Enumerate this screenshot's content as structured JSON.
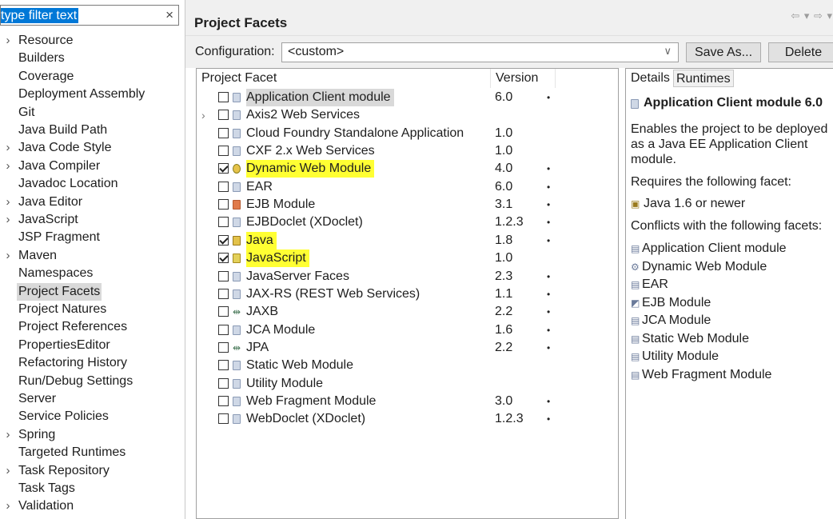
{
  "filter": {
    "text": "type filter text",
    "clear_icon": "×"
  },
  "tree": {
    "items": [
      {
        "label": "Resource",
        "expandable": true
      },
      {
        "label": "Builders",
        "expandable": false
      },
      {
        "label": "Coverage",
        "expandable": false
      },
      {
        "label": "Deployment Assembly",
        "expandable": false
      },
      {
        "label": "Git",
        "expandable": false
      },
      {
        "label": "Java Build Path",
        "expandable": false
      },
      {
        "label": "Java Code Style",
        "expandable": true
      },
      {
        "label": "Java Compiler",
        "expandable": true
      },
      {
        "label": "Javadoc Location",
        "expandable": false
      },
      {
        "label": "Java Editor",
        "expandable": true
      },
      {
        "label": "JavaScript",
        "expandable": true
      },
      {
        "label": "JSP Fragment",
        "expandable": false
      },
      {
        "label": "Maven",
        "expandable": true
      },
      {
        "label": "Namespaces",
        "expandable": false
      },
      {
        "label": "Project Facets",
        "expandable": false,
        "selected": true
      },
      {
        "label": "Project Natures",
        "expandable": false
      },
      {
        "label": "Project References",
        "expandable": false
      },
      {
        "label": "PropertiesEditor",
        "expandable": false
      },
      {
        "label": "Refactoring History",
        "expandable": false
      },
      {
        "label": "Run/Debug Settings",
        "expandable": false
      },
      {
        "label": "Server",
        "expandable": false
      },
      {
        "label": "Service Policies",
        "expandable": false
      },
      {
        "label": "Spring",
        "expandable": true
      },
      {
        "label": "Targeted Runtimes",
        "expandable": false
      },
      {
        "label": "Task Repository",
        "expandable": true
      },
      {
        "label": "Task Tags",
        "expandable": false
      },
      {
        "label": "Validation",
        "expandable": true
      }
    ]
  },
  "header": {
    "title": "Project Facets",
    "nav": "⇦ ▾ ⇨ ▾"
  },
  "config": {
    "label": "Configuration:",
    "value": "<custom>",
    "save_as": "Save As...",
    "delete": "Delete"
  },
  "facets": {
    "col_facet": "Project Facet",
    "col_version": "Version",
    "rows": [
      {
        "name": "Application Client module",
        "version": "6.0",
        "checked": false,
        "dropdown": true,
        "icon": "doc",
        "style": "sel",
        "expander": false
      },
      {
        "name": "Axis2 Web Services",
        "version": "",
        "checked": false,
        "dropdown": false,
        "icon": "doc",
        "style": "",
        "expander": true
      },
      {
        "name": "Cloud Foundry Standalone Application",
        "version": "1.0",
        "checked": false,
        "dropdown": false,
        "icon": "doc",
        "style": "",
        "expander": false
      },
      {
        "name": "CXF 2.x Web Services",
        "version": "1.0",
        "checked": false,
        "dropdown": false,
        "icon": "doc",
        "style": "",
        "expander": false
      },
      {
        "name": "Dynamic Web Module",
        "version": "4.0",
        "checked": true,
        "dropdown": true,
        "icon": "gear",
        "style": "hl",
        "expander": false
      },
      {
        "name": "EAR",
        "version": "6.0",
        "checked": false,
        "dropdown": true,
        "icon": "doc",
        "style": "",
        "expander": false
      },
      {
        "name": "EJB Module",
        "version": "3.1",
        "checked": false,
        "dropdown": true,
        "icon": "ejb",
        "style": "",
        "expander": false
      },
      {
        "name": "EJBDoclet (XDoclet)",
        "version": "1.2.3",
        "checked": false,
        "dropdown": true,
        "icon": "doc",
        "style": "",
        "expander": false
      },
      {
        "name": "Java",
        "version": "1.8",
        "checked": true,
        "dropdown": true,
        "icon": "java",
        "style": "hl",
        "expander": false
      },
      {
        "name": "JavaScript",
        "version": "1.0",
        "checked": true,
        "dropdown": false,
        "icon": "js",
        "style": "hl",
        "expander": false
      },
      {
        "name": "JavaServer Faces",
        "version": "2.3",
        "checked": false,
        "dropdown": true,
        "icon": "doc",
        "style": "",
        "expander": false
      },
      {
        "name": "JAX-RS (REST Web Services)",
        "version": "1.1",
        "checked": false,
        "dropdown": true,
        "icon": "doc",
        "style": "",
        "expander": false
      },
      {
        "name": "JAXB",
        "version": "2.2",
        "checked": false,
        "dropdown": true,
        "icon": "arrow",
        "style": "",
        "expander": false
      },
      {
        "name": "JCA Module",
        "version": "1.6",
        "checked": false,
        "dropdown": true,
        "icon": "doc",
        "style": "",
        "expander": false
      },
      {
        "name": "JPA",
        "version": "2.2",
        "checked": false,
        "dropdown": true,
        "icon": "arrow",
        "style": "",
        "expander": false
      },
      {
        "name": "Static Web Module",
        "version": "",
        "checked": false,
        "dropdown": false,
        "icon": "doc",
        "style": "",
        "expander": false
      },
      {
        "name": "Utility Module",
        "version": "",
        "checked": false,
        "dropdown": false,
        "icon": "doc",
        "style": "",
        "expander": false
      },
      {
        "name": "Web Fragment Module",
        "version": "3.0",
        "checked": false,
        "dropdown": true,
        "icon": "doc",
        "style": "",
        "expander": false
      },
      {
        "name": "WebDoclet (XDoclet)",
        "version": "1.2.3",
        "checked": false,
        "dropdown": true,
        "icon": "doc",
        "style": "",
        "expander": false
      }
    ]
  },
  "details": {
    "tab_details": "Details",
    "tab_runtimes": "Runtimes",
    "title": "Application Client module 6.0",
    "description": "Enables the project to be deployed as a Java EE Application Client module.",
    "requires_label": "Requires the following facet:",
    "requires_item": "Java 1.6 or newer",
    "conflicts_label": "Conflicts with the following facets:",
    "conflicts": [
      {
        "name": "Application Client module",
        "icon": "doc"
      },
      {
        "name": "Dynamic Web Module",
        "icon": "gear"
      },
      {
        "name": "EAR",
        "icon": "doc"
      },
      {
        "name": "EJB Module",
        "icon": "ejb"
      },
      {
        "name": "JCA Module",
        "icon": "doc"
      },
      {
        "name": "Static Web Module",
        "icon": "doc"
      },
      {
        "name": "Utility Module",
        "icon": "doc"
      },
      {
        "name": "Web Fragment Module",
        "icon": "doc"
      }
    ]
  }
}
